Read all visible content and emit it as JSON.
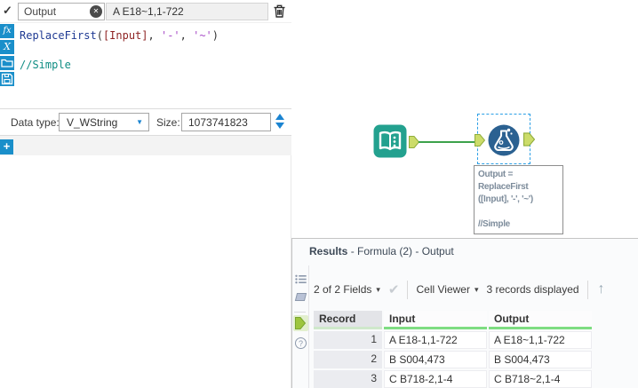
{
  "formula_panel": {
    "output_name": "Output",
    "preview_value": "A E18~1,1-722",
    "expression": {
      "segments": [
        {
          "text": "ReplaceFirst"
        },
        {
          "text": "("
        },
        {
          "text": "[Input]"
        },
        {
          "text": ", "
        },
        {
          "text": "'-'"
        },
        {
          "text": ", "
        },
        {
          "text": "'~'"
        },
        {
          "text": ")"
        }
      ],
      "comment": "//Simple"
    },
    "data_type_label": "Data type:",
    "data_type_value": "V_WString",
    "size_label": "Size:",
    "size_value": "1073741823"
  },
  "canvas": {
    "annotation_lines": [
      "Output =",
      "ReplaceFirst",
      "([Input], '-', '~')",
      "",
      "//Simple"
    ]
  },
  "results": {
    "title_bold": "Results",
    "title_rest": " - Formula (2) - Output",
    "toolbar": {
      "fields_button": "2 of 2 Fields",
      "cell_viewer_button": "Cell Viewer",
      "records_status": "3 records displayed"
    },
    "table": {
      "columns": {
        "record": "Record",
        "input": "Input",
        "output": "Output"
      },
      "rows": [
        {
          "record": "1",
          "input": "A E18-1,1-722",
          "output": "A E18~1,1-722"
        },
        {
          "record": "2",
          "input": "B S004,473",
          "output": "B S004,473"
        },
        {
          "record": "3",
          "input": "C B718-2,1-4",
          "output": "C B718~2,1-4"
        }
      ]
    }
  },
  "icons": {
    "validate_check": "✓",
    "clear_x": "✕",
    "dropdown_arrow": "▼",
    "caret_down": "▾",
    "apply_check": "✔",
    "up_arrow": "↑",
    "plus": "+",
    "question_mark": "?",
    "fx_label": "fx",
    "variables_label": "X"
  },
  "colors": {
    "accent_blue": "#1a8fca",
    "tool_teal": "#23a18f",
    "tool_dark_blue": "#2b6191",
    "connection_green": "#3da24b",
    "anchor_green": "#ccdc6a",
    "selection_blue": "#2b9fe6",
    "table_header_green": "#7edd82",
    "syntax_function": "#1f3a93",
    "syntax_field": "#8e2323",
    "syntax_string": "#a74ac7",
    "syntax_comment": "#0f8d83"
  }
}
